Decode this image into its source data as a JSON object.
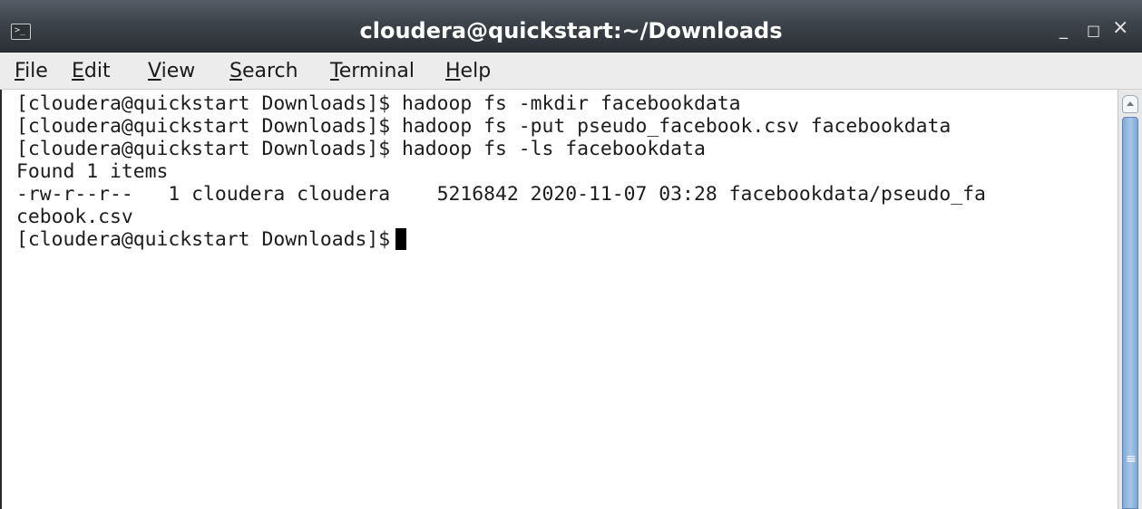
{
  "window": {
    "title": "cloudera@quickstart:~/Downloads",
    "icon": "terminal-icon",
    "controls": {
      "minimize": "_",
      "maximize": "□",
      "close": "×"
    }
  },
  "menubar": {
    "items": [
      {
        "accel": "F",
        "rest": "ile"
      },
      {
        "accel": "E",
        "rest": "dit"
      },
      {
        "accel": "V",
        "rest": "iew"
      },
      {
        "accel": "S",
        "rest": "earch"
      },
      {
        "accel": "T",
        "rest": "erminal"
      },
      {
        "accel": "H",
        "rest": "elp"
      }
    ]
  },
  "terminal": {
    "lines": [
      "[cloudera@quickstart Downloads]$ hadoop fs -mkdir facebookdata",
      "[cloudera@quickstart Downloads]$ hadoop fs -put pseudo_facebook.csv facebookdata",
      "[cloudera@quickstart Downloads]$ hadoop fs -ls facebookdata",
      "Found 1 items",
      "-rw-r--r--   1 cloudera cloudera    5216842 2020-11-07 03:28 facebookdata/pseudo_fa",
      "cebook.csv"
    ],
    "prompt": "[cloudera@quickstart Downloads]$"
  },
  "scrollbar": {
    "grip": "≡"
  },
  "colors": {
    "titlebar": "#3d434a",
    "menubar": "#ececec",
    "terminal_bg": "#ffffff",
    "terminal_fg": "#1c1c1c",
    "scroll_thumb": "#a8c6e6"
  }
}
